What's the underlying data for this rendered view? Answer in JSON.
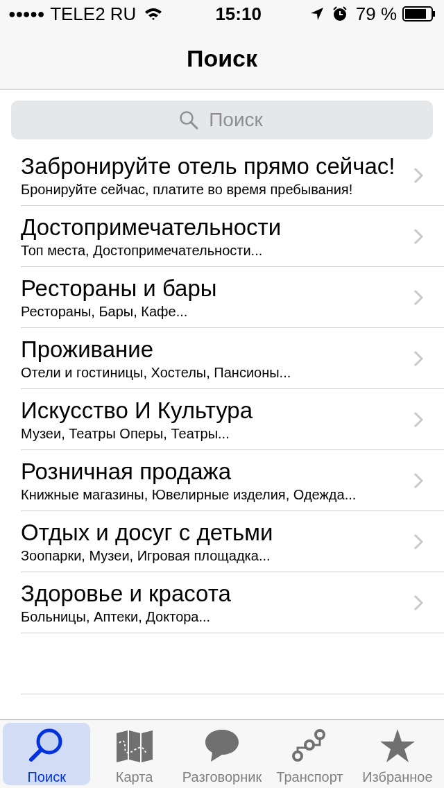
{
  "status_bar": {
    "signal_dots": "●●●●●",
    "carrier": "TELE2 RU",
    "time": "15:10",
    "battery": "79 %"
  },
  "nav": {
    "title": "Поиск"
  },
  "search": {
    "placeholder": "Поиск"
  },
  "items": [
    {
      "title": "Забронируйте отель прямо сейчас!",
      "subtitle": "Бронируйте сейчас, платите во время пребывания!"
    },
    {
      "title": "Достопримечательности",
      "subtitle": "Топ места, Достопримечательности..."
    },
    {
      "title": "Рестораны и бары",
      "subtitle": "Рестораны, Бары, Кафе..."
    },
    {
      "title": "Проживание",
      "subtitle": "Отели и гостиницы, Хостелы, Пансионы..."
    },
    {
      "title": "Искусство И Культура",
      "subtitle": "Музеи, Театры Оперы, Театры..."
    },
    {
      "title": "Розничная продажа",
      "subtitle": "Книжные магазины, Ювелирные изделия, Одежда..."
    },
    {
      "title": "Отдых и досуг с детьми",
      "subtitle": "Зоопарки, Музеи, Игровая площадка..."
    },
    {
      "title": "Здоровье и красота",
      "subtitle": "Больницы, Аптеки, Доктора..."
    }
  ],
  "tabs": [
    {
      "kind": "search",
      "label": "Поиск",
      "selected": true
    },
    {
      "kind": "map",
      "label": "Карта",
      "selected": false
    },
    {
      "kind": "chat",
      "label": "Разговорник",
      "selected": false
    },
    {
      "kind": "route",
      "label": "Транспорт",
      "selected": false
    },
    {
      "kind": "star",
      "label": "Избранное",
      "selected": false
    }
  ]
}
